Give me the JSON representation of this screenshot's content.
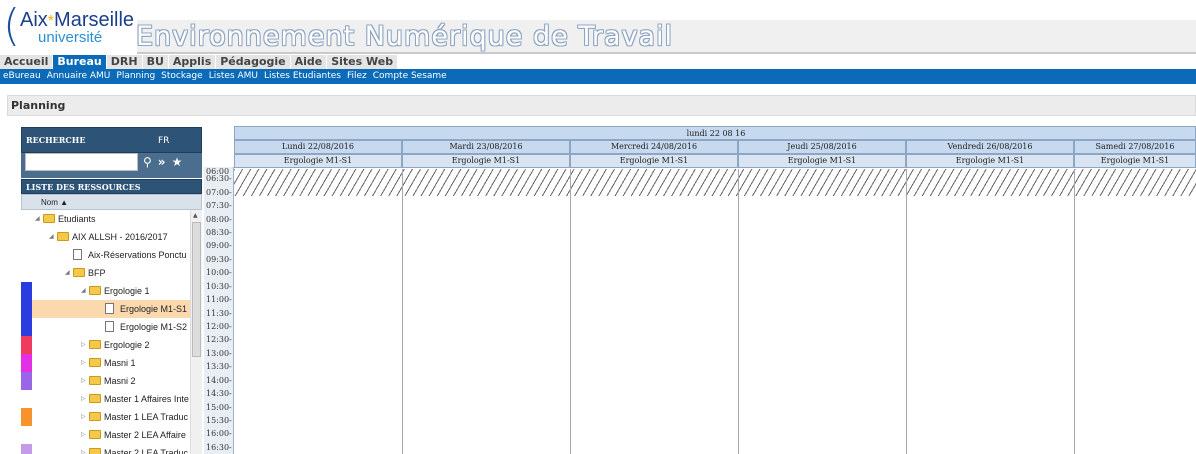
{
  "logo": {
    "line1_a": "Aix",
    "line1_star": "*",
    "line1_b": "Marseille",
    "line2": "université"
  },
  "site_title": "Environnement Numérique de Travail",
  "nav": {
    "tabs": [
      "Accueil",
      "Bureau",
      "DRH",
      "BU",
      "Applis",
      "Pédagogie",
      "Aide",
      "Sites Web"
    ],
    "active": "Bureau",
    "subtabs": [
      "eBureau",
      "Annuaire AMU",
      "Planning",
      "Stockage",
      "Listes AMU",
      "Listes Etudiantes",
      "Filez",
      "Compte Sesame"
    ]
  },
  "page_title": "Planning",
  "search": {
    "label": "RECHERCHE",
    "lang": "FR",
    "value": "",
    "icons": [
      "search-icon",
      "forward-icon",
      "star-icon"
    ]
  },
  "resources": {
    "title": "LISTE DES RESSOURCES",
    "column": "Nom ▲",
    "tree": [
      {
        "label": "Etudiants",
        "kind": "folder",
        "level": 0,
        "expanded": true,
        "color": null,
        "selected": false
      },
      {
        "label": "AIX ALLSH - 2016/2017",
        "kind": "folder",
        "level": 1,
        "expanded": true,
        "color": null,
        "selected": false
      },
      {
        "label": "Aix-Réservations Ponctu",
        "kind": "doc",
        "level": 2,
        "expanded": null,
        "color": null,
        "selected": false
      },
      {
        "label": "BFP",
        "kind": "folder",
        "level": 2,
        "expanded": true,
        "color": null,
        "selected": false
      },
      {
        "label": "Ergologie 1",
        "kind": "folder",
        "level": 3,
        "expanded": true,
        "color": "#2c3de0",
        "selected": false
      },
      {
        "label": "Ergologie M1-S1",
        "kind": "doc",
        "level": 4,
        "expanded": null,
        "color": "#2c3de0",
        "selected": true
      },
      {
        "label": "Ergologie M1-S2",
        "kind": "doc",
        "level": 4,
        "expanded": null,
        "color": "#2c3de0",
        "selected": false
      },
      {
        "label": "Ergologie 2",
        "kind": "folder",
        "level": 3,
        "expanded": false,
        "color": "#f03a5e",
        "selected": false
      },
      {
        "label": "Masni 1",
        "kind": "folder",
        "level": 3,
        "expanded": false,
        "color": "#e430e4",
        "selected": false
      },
      {
        "label": "Masni 2",
        "kind": "folder",
        "level": 3,
        "expanded": false,
        "color": "#9a66e8",
        "selected": false
      },
      {
        "label": "Master 1 Affaires Inte",
        "kind": "folder",
        "level": 3,
        "expanded": false,
        "color": null,
        "selected": false
      },
      {
        "label": "Master 1 LEA Traduc",
        "kind": "folder",
        "level": 3,
        "expanded": false,
        "color": "#f8922c",
        "selected": false
      },
      {
        "label": "Master 2 LEA Affaire",
        "kind": "folder",
        "level": 3,
        "expanded": false,
        "color": null,
        "selected": false
      },
      {
        "label": "Master 2 LEA Traduc",
        "kind": "folder",
        "level": 3,
        "expanded": false,
        "color": "#c49be8",
        "selected": false
      }
    ]
  },
  "calendar": {
    "week_label": "lundi 22 08 16",
    "days": [
      {
        "label": "Lundi 22/08/2016",
        "group": "Ergologie M1-S1"
      },
      {
        "label": "Mardi 23/08/2016",
        "group": "Ergologie M1-S1"
      },
      {
        "label": "Mercredi 24/08/2016",
        "group": "Ergologie M1-S1"
      },
      {
        "label": "Jeudi 25/08/2016",
        "group": "Ergologie M1-S1"
      },
      {
        "label": "Vendredi 26/08/2016",
        "group": "Ergologie M1-S1"
      },
      {
        "label": "Samedi 27/08/2016",
        "group": "Ergologie M1-S1"
      }
    ],
    "times": [
      "06:00",
      "06:30-",
      "07:00-",
      "07:30-",
      "08:00-",
      "08:30-",
      "09:00-",
      "09:30-",
      "10:00-",
      "10:30-",
      "11:00-",
      "11:30-",
      "12:00-",
      "12:30-",
      "13:00-",
      "13:30-",
      "14:00-",
      "14:30-",
      "15:00-",
      "15:30-",
      "16:00-",
      "16:30-"
    ]
  }
}
